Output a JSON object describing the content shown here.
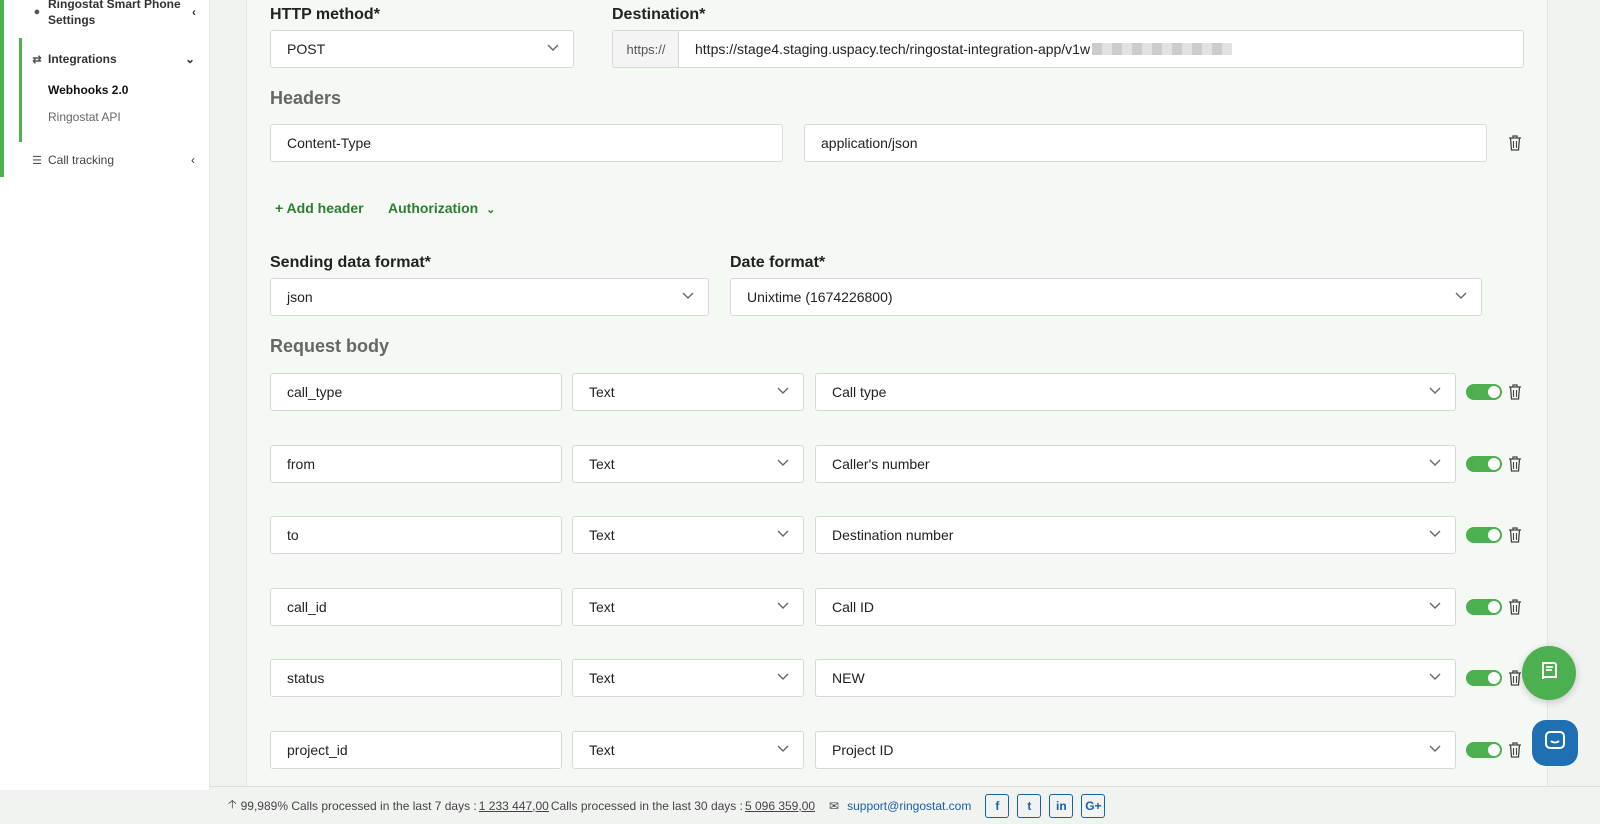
{
  "sidebar": {
    "smart_phone_settings": "Ringostat Smart Phone Settings",
    "integrations": "Integrations",
    "webhooks": "Webhooks 2.0",
    "ringostat_api": "Ringostat API",
    "call_tracking": "Call tracking"
  },
  "form": {
    "http_method_label": "HTTP method*",
    "http_method_value": "POST",
    "destination_label": "Destination*",
    "destination_prefix": "https://",
    "destination_value": "https://stage4.staging.uspacy.tech/ringostat-integration-app/v1w",
    "headers_title": "Headers",
    "header_key": "Content-Type",
    "header_value": "application/json",
    "add_header": "+ Add header",
    "authorization": "Authorization",
    "sending_format_label": "Sending data format*",
    "sending_format_value": "json",
    "date_format_label": "Date format*",
    "date_format_value": "Unixtime (1674226800)",
    "request_body_title": "Request body"
  },
  "body_rows": [
    {
      "key": "call_type",
      "type": "Text",
      "value": "Call type"
    },
    {
      "key": "from",
      "type": "Text",
      "value": "Caller's number"
    },
    {
      "key": "to",
      "type": "Text",
      "value": "Destination number"
    },
    {
      "key": "call_id",
      "type": "Text",
      "value": "Call ID"
    },
    {
      "key": "status",
      "type": "Text",
      "value": "NEW"
    },
    {
      "key": "project_id",
      "type": "Text",
      "value": "Project ID"
    }
  ],
  "footer": {
    "uptime": "99,989%",
    "calls_7_label": "Calls processed in the last 7 days :",
    "calls_7_value": "1 233 447,00",
    "calls_30_label": "Calls processed in the last 30 days :",
    "calls_30_value": "5 096 359,00",
    "email": "support@ringostat.com",
    "social": [
      "f",
      "t",
      "in",
      "G+"
    ]
  },
  "colors": {
    "accent": "#4caf50",
    "link": "#2e7d32",
    "footer_link": "#1a5fa8"
  }
}
